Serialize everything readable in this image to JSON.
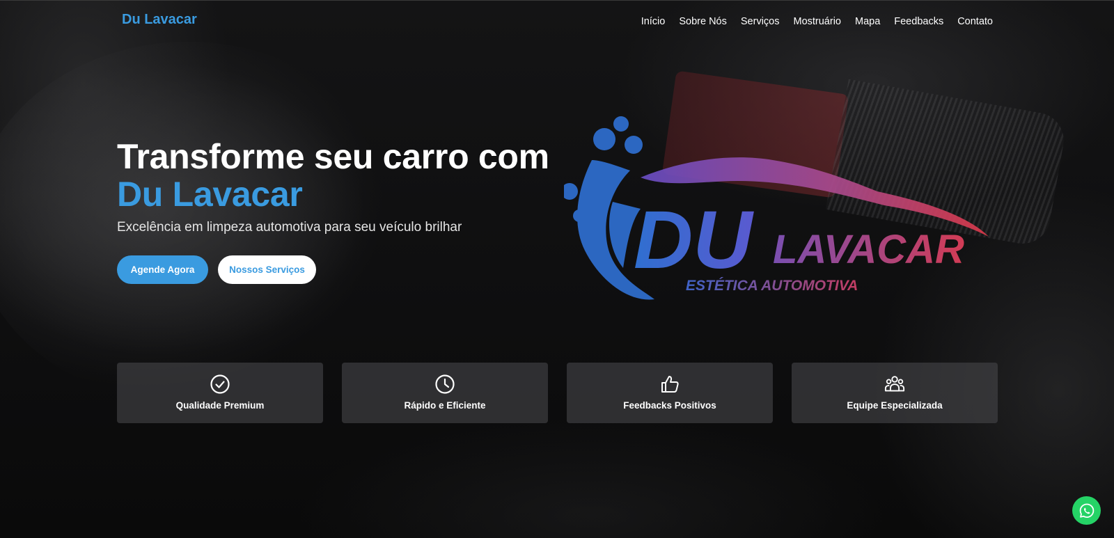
{
  "nav": {
    "brand": "Du Lavacar",
    "links": [
      "Início",
      "Sobre Nós",
      "Serviços",
      "Mostruário",
      "Mapa",
      "Feedbacks",
      "Contato"
    ]
  },
  "hero": {
    "title_line1": "Transforme seu carro com",
    "title_accent": "Du Lavacar",
    "subtitle": "Excelência em limpeza automotiva para seu veículo brilhar",
    "primary_button": "Agende Agora",
    "secondary_button": "Nossos Serviços"
  },
  "logo": {
    "text_du": "DU",
    "text_lavacar": "LAVACAR",
    "tagline": "ESTÉTICA AUTOMOTIVA"
  },
  "features": [
    {
      "icon": "check-circle-icon",
      "label": "Qualidade Premium"
    },
    {
      "icon": "clock-icon",
      "label": "Rápido e Eficiente"
    },
    {
      "icon": "thumbs-up-icon",
      "label": "Feedbacks Positivos"
    },
    {
      "icon": "team-icon",
      "label": "Equipe Especializada"
    }
  ],
  "whatsapp": {
    "icon": "whatsapp-icon"
  },
  "colors": {
    "accent": "#3a9be0",
    "whatsapp": "#25d366",
    "logo_blue": "#2f6fd0",
    "logo_red": "#e03a4a"
  }
}
